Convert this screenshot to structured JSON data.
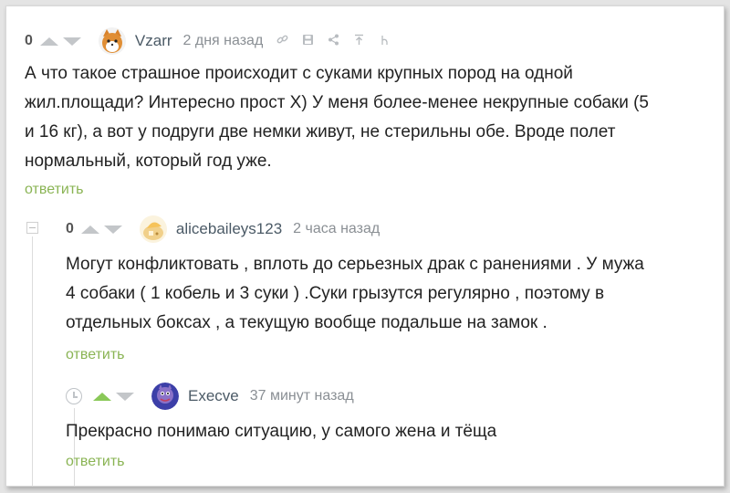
{
  "colors": {
    "accent_green": "#8ab454",
    "vote_active": "#8ac858",
    "vote_inactive": "#c3c6c9",
    "author": "#4b5a66",
    "meta": "#8a8f94"
  },
  "comments": [
    {
      "rating": "0",
      "author": "Vzarr",
      "time": "2 дня назад",
      "tools": [
        "link-icon",
        "save-icon",
        "share-icon",
        "scroll-top-icon",
        "ignore-icon"
      ],
      "lines": [
        "А что такое страшное происходит с суками крупных пород на одной",
        "жил.площади? Интересно прост Х) У меня более-менее некрупные собаки (5",
        "и 16 кг), а вот у подруги две немки живут, не стерильны обе. Вроде полет",
        "нормальный, который год уже."
      ],
      "reply": "ответить"
    },
    {
      "rating": "0",
      "author": "alicebaileys123",
      "time": "2 часа назад",
      "lines": [
        "Могут конфликтовать , вплоть до серьезных драк с ранениями . У мужа",
        "4 собаки ( 1 кобель и 3 суки ) .Суки грызутся регулярно , поэтому в",
        "отдельных боксах , а текущую вообще подальше на замок ."
      ],
      "reply": "ответить"
    },
    {
      "author": "Execve",
      "time": "37 минут назад",
      "lines": [
        "Прекрасно понимаю ситуацию, у самого жена и тёща"
      ],
      "reply": "ответить"
    }
  ]
}
